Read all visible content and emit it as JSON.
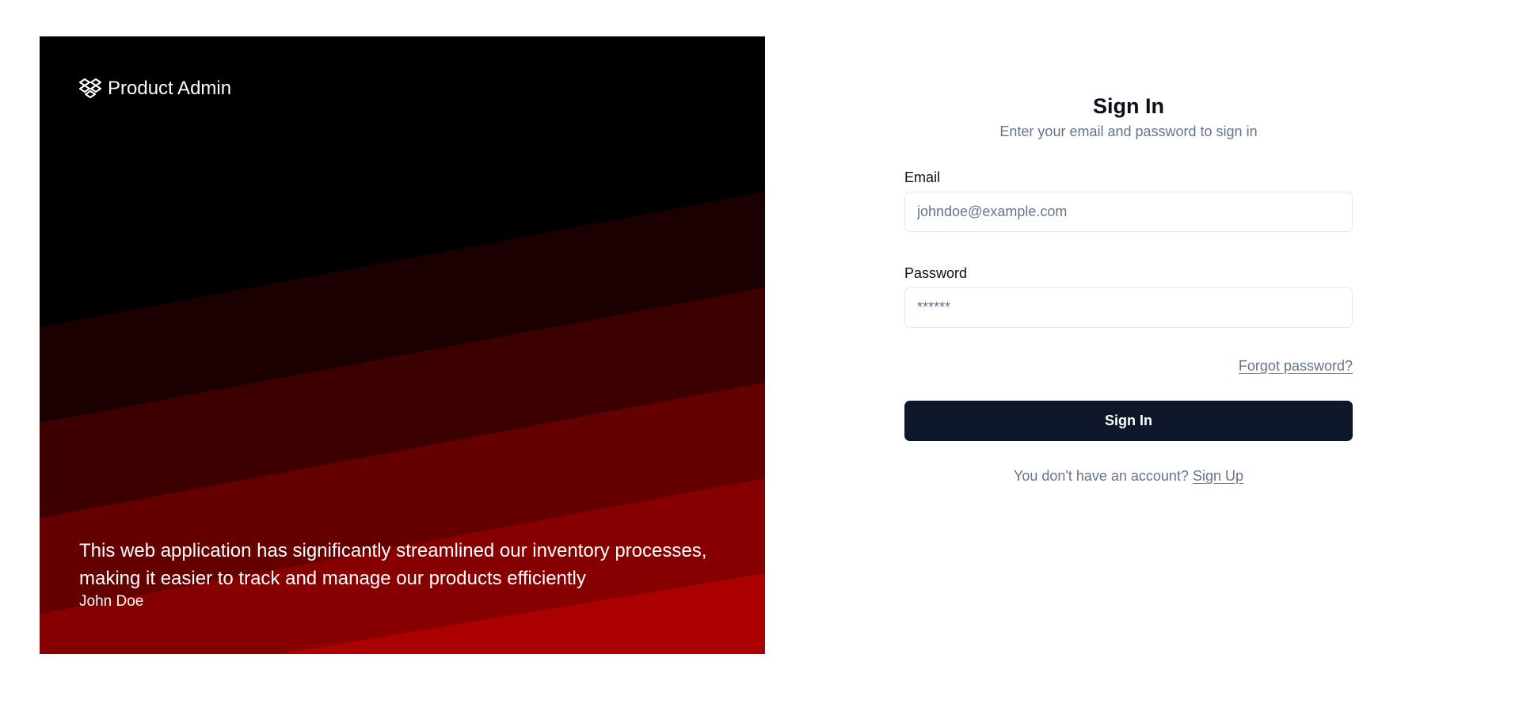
{
  "hero": {
    "brand": "Product Admin",
    "logo_icon": "dropbox-like-layers-icon",
    "quote": "This web application has significantly streamlined our inventory processes, making it easier to track and manage our products efficiently",
    "author": "John Doe",
    "colors": {
      "background": "#000000",
      "band1": "#1a0000",
      "band2": "#3d0000",
      "band3": "#640000",
      "band4": "#860000",
      "band5": "#aa0000"
    }
  },
  "form": {
    "title": "Sign In",
    "subtitle": "Enter your email and password to sign in",
    "email_label": "Email",
    "email_placeholder": "johndoe@example.com",
    "password_label": "Password",
    "password_placeholder": "******",
    "forgot_label": "Forgot password?",
    "submit_label": "Sign In",
    "signup_prompt": "You don't have an account?",
    "signup_link": "Sign Up"
  },
  "colors": {
    "primary_button": "#0f172a",
    "muted_text": "#64748b",
    "input_border": "#e2e8f0"
  }
}
